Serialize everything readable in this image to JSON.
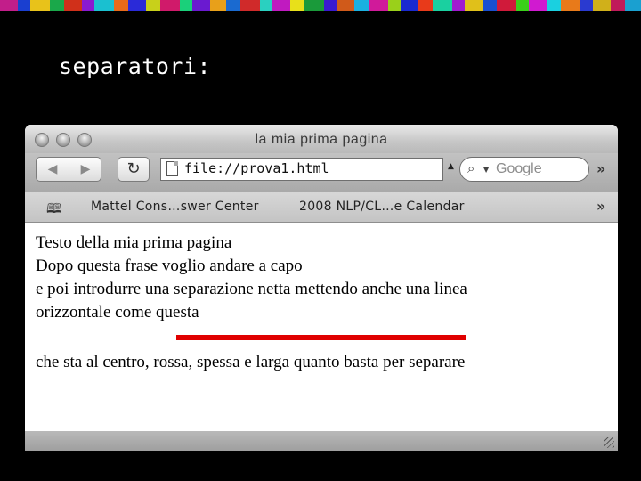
{
  "slide": {
    "title": "separatori:"
  },
  "window": {
    "title": "la mia prima pagina"
  },
  "toolbar": {
    "url": "file://prova1.html",
    "search_placeholder": "Google",
    "back_icon": "back-arrow-icon",
    "forward_icon": "forward-arrow-icon",
    "reload_icon": "reload-icon"
  },
  "bookmarks": {
    "items": [
      {
        "label": "Mattel Cons…swer Center"
      },
      {
        "label": "2008 NLP/CL…e Calendar"
      }
    ]
  },
  "page": {
    "lines": [
      "Testo della mia prima pagina",
      "Dopo questa frase voglio andare a capo",
      "e poi introdurre una separazione netta mettendo anche una linea",
      "orizzontale come questa"
    ],
    "after_rule": "che sta al centro, rossa, spessa e larga quanto basta per separare",
    "rule_color": "#e00000"
  }
}
